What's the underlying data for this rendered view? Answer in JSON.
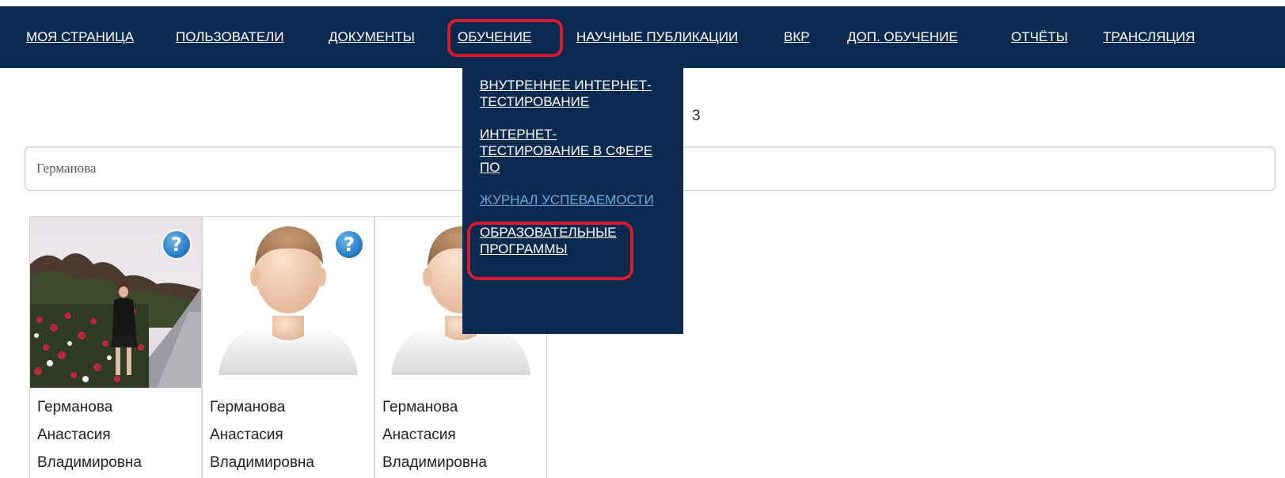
{
  "nav": {
    "items": [
      {
        "label": "МОЯ СТРАНИЦА"
      },
      {
        "label": "ПОЛЬЗОВАТЕЛИ"
      },
      {
        "label": "ДОКУМЕНТЫ"
      },
      {
        "label": "ОБУЧЕНИЕ"
      },
      {
        "label": "НАУЧНЫЕ ПУБЛИКАЦИИ"
      },
      {
        "label": "ВКР"
      },
      {
        "label": "ДОП. ОБУЧЕНИЕ"
      },
      {
        "label": "ОТЧЁТЫ"
      },
      {
        "label": "ТРАНСЛЯЦИЯ"
      }
    ],
    "active": "ОБУЧЕНИЕ"
  },
  "dropdown": {
    "items": [
      {
        "label": "ВНУТРЕННЕЕ ИНТЕРНЕТ-ТЕСТИРОВАНИЕ"
      },
      {
        "label": "ИНТЕРНЕТ-ТЕСТИРОВАНИЕ В СФЕРЕ ПО"
      },
      {
        "label": "ЖУРНАЛ УСПЕВАЕМОСТИ"
      },
      {
        "label": "ОБРАЗОВАТЕЛЬНЫЕ ПРОГРАММЫ"
      }
    ],
    "highlighted": "ЖУРНАЛ УСПЕВАЕМОСТИ"
  },
  "results": {
    "count_fragment": "3"
  },
  "search": {
    "value": "Германова"
  },
  "users": [
    {
      "last_name": "Германова",
      "first_name": "Анастасия",
      "patronymic": "Владимировна",
      "photo": "photo",
      "help_icon": "question-icon"
    },
    {
      "last_name": "Германова",
      "first_name": "Анастасия",
      "patronymic": "Владимировна",
      "photo": "default-avatar",
      "help_icon": "question-icon"
    },
    {
      "last_name": "Германова",
      "first_name": "Анастасия",
      "patronymic": "Владимировна",
      "photo": "default-avatar",
      "help_icon": null
    }
  ],
  "colors": {
    "nav_bg": "#0c2a4f",
    "highlight": "#d81b2b",
    "active_link": "#6fa8e0"
  }
}
